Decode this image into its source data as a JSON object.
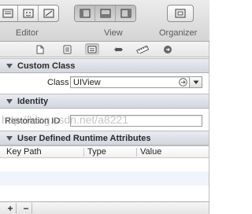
{
  "toolbar": {
    "editor_label": "Editor",
    "view_label": "View",
    "organizer_label": "Organizer"
  },
  "inspector_tabs": [
    "file-icon",
    "quick-help-icon",
    "identity-icon",
    "attributes-icon",
    "size-icon",
    "connections-icon"
  ],
  "custom_class": {
    "header": "Custom Class",
    "class_label": "Class",
    "class_value": "UIView"
  },
  "identity": {
    "header": "Identity",
    "restoration_id_label": "Restoration ID",
    "restoration_id_value": ""
  },
  "runtime_attributes": {
    "header": "User Defined Runtime Attributes",
    "columns": [
      "Key Path",
      "Type",
      "Value"
    ]
  },
  "bottom_bar": {
    "add_label": "+",
    "remove_label": "−"
  },
  "watermark": "http://blog.csdn.net/a8221",
  "colors": {
    "section_header_bg": "#d2d7de",
    "row_alt_bg": "#f0f4fb",
    "toolbar_bg": "#d4d4d4"
  }
}
